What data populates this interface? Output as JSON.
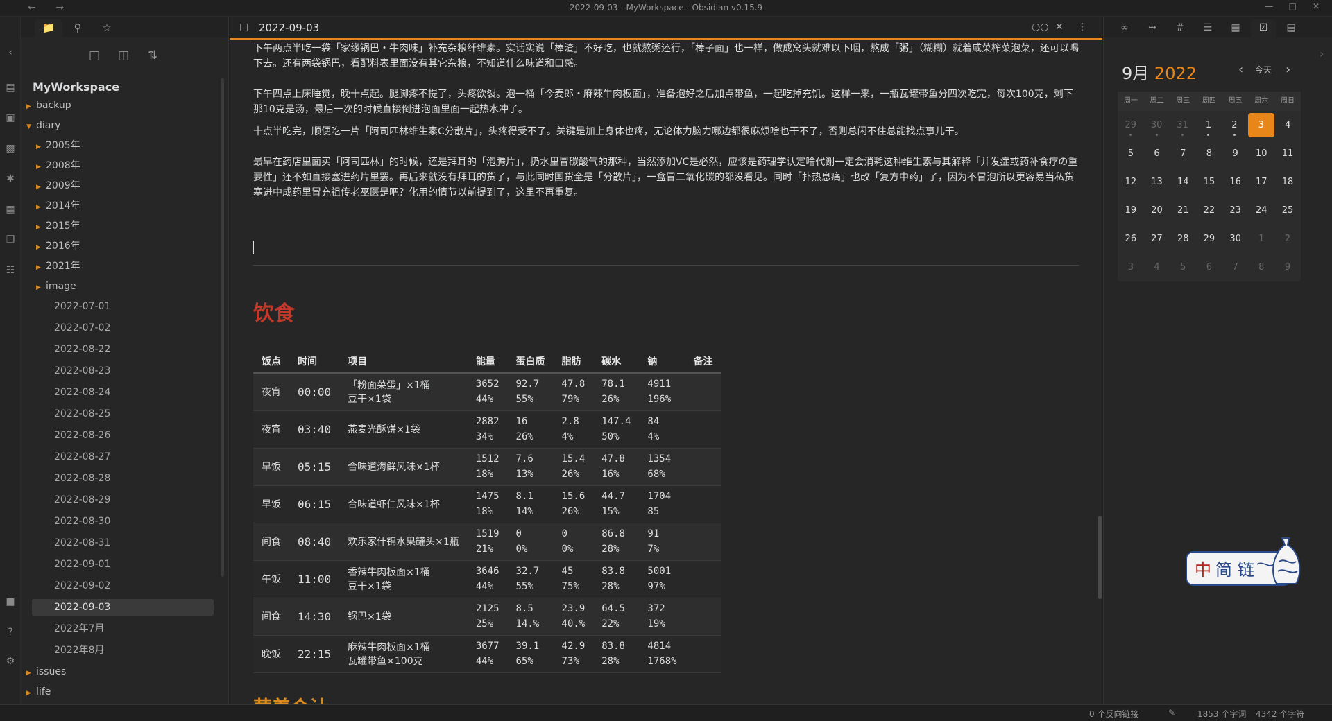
{
  "window": {
    "title": "2022-09-03 - MyWorkspace - Obsidian v0.15.9"
  },
  "left_sidebar": {
    "vault_name": "MyWorkspace",
    "tree": [
      {
        "label": "backup",
        "type": "folder",
        "level": 0
      },
      {
        "label": "diary",
        "type": "folder-open",
        "level": 0
      },
      {
        "label": "2005年",
        "type": "folder",
        "level": 1
      },
      {
        "label": "2008年",
        "type": "folder",
        "level": 1
      },
      {
        "label": "2009年",
        "type": "folder",
        "level": 1
      },
      {
        "label": "2014年",
        "type": "folder",
        "level": 1
      },
      {
        "label": "2015年",
        "type": "folder",
        "level": 1
      },
      {
        "label": "2016年",
        "type": "folder",
        "level": 1
      },
      {
        "label": "2021年",
        "type": "folder",
        "level": 1
      },
      {
        "label": "image",
        "type": "folder",
        "level": 1
      },
      {
        "label": "2022-07-01",
        "type": "file",
        "level": 1
      },
      {
        "label": "2022-07-02",
        "type": "file",
        "level": 1
      },
      {
        "label": "2022-08-22",
        "type": "file",
        "level": 1
      },
      {
        "label": "2022-08-23",
        "type": "file",
        "level": 1
      },
      {
        "label": "2022-08-24",
        "type": "file",
        "level": 1
      },
      {
        "label": "2022-08-25",
        "type": "file",
        "level": 1
      },
      {
        "label": "2022-08-26",
        "type": "file",
        "level": 1
      },
      {
        "label": "2022-08-27",
        "type": "file",
        "level": 1
      },
      {
        "label": "2022-08-28",
        "type": "file",
        "level": 1
      },
      {
        "label": "2022-08-29",
        "type": "file",
        "level": 1
      },
      {
        "label": "2022-08-30",
        "type": "file",
        "level": 1
      },
      {
        "label": "2022-08-31",
        "type": "file",
        "level": 1
      },
      {
        "label": "2022-09-01",
        "type": "file",
        "level": 1
      },
      {
        "label": "2022-09-02",
        "type": "file",
        "level": 1
      },
      {
        "label": "2022-09-03",
        "type": "file",
        "level": 1,
        "active": true
      },
      {
        "label": "2022年7月",
        "type": "file",
        "level": 1
      },
      {
        "label": "2022年8月",
        "type": "file",
        "level": 1
      },
      {
        "label": "issues",
        "type": "folder",
        "level": 0
      },
      {
        "label": "life",
        "type": "folder",
        "level": 0
      }
    ]
  },
  "editor": {
    "tab_title": "2022-09-03",
    "paragraphs": [
      "下午两点半吃一袋「家缘锅巴・牛肉味」补充杂粮纤维素。实话实说「棒渣」不好吃，也就熬粥还行，「棒子面」也一样，做成窝头就难以下咽，熬成「粥」（糊糊）就着咸菜榨菜泡菜，还可以喝下去。还有两袋锅巴，看配料表里面没有其它杂粮，不知道什么味道和口感。",
      "下午四点上床睡觉，晚十点起。腿脚疼不提了，头疼欲裂。泡一桶「今麦郎・麻辣牛肉板面」，准备泡好之后加点带鱼，一起吃掉充饥。这样一来，一瓶瓦罐带鱼分四次吃完，每次100克，剩下那10克是汤，最后一次的时候直接倒进泡面里面一起热水冲了。",
      "十点半吃完，顺便吃一片「阿司匹林维生素C分散片」，头疼得受不了。关键是加上身体也疼，无论体力脑力哪边都很麻烦啥也干不了，否则总闲不住总能找点事儿干。",
      "最早在药店里面买「阿司匹林」的时候，还是拜耳的「泡腾片」，扔水里冒碳酸气的那种，当然添加VC是必然，应该是药理学认定啥代谢一定会消耗这种维生素与其解释「并发症或药补食疗の重要性」还不如直接塞进药片里罢。再后来就没有拜耳的货了，与此同时国货全是「分散片」，一盒冒二氧化碳的都没看见。同时「扑热息痛」也改「复方中药」了，因为不冒泡所以更容易当私货塞进中成药里冒充祖传老巫医是吧？化用的情节以前提到了，这里不再重复。"
    ],
    "heading_food": "饮食",
    "heading_nutrition": "营养合计",
    "table": {
      "headers": [
        "饭点",
        "时间",
        "项目",
        "能量",
        "蛋白质",
        "脂肪",
        "碳水",
        "钠",
        "备注"
      ],
      "rows": [
        {
          "meal": "夜宵",
          "time": "00:00",
          "item1": "「粉面菜蛋」×1桶",
          "item2": "豆干×1袋",
          "energy": "3652",
          "energy_pct": "44%",
          "protein": "92.7",
          "protein_pct": "55%",
          "fat": "47.8",
          "fat_pct": "79%",
          "carb": "78.1",
          "carb_pct": "26%",
          "sodium": "4911",
          "sodium_pct": "196%",
          "note": ""
        },
        {
          "meal": "夜宵",
          "time": "03:40",
          "item1": "燕麦光酥饼×1袋",
          "item2": "",
          "energy": "2882",
          "energy_pct": "34%",
          "protein": "16",
          "protein_pct": "26%",
          "fat": "2.8",
          "fat_pct": "4%",
          "carb": "147.4",
          "carb_pct": "50%",
          "sodium": "84",
          "sodium_pct": "4%",
          "note": ""
        },
        {
          "meal": "早饭",
          "time": "05:15",
          "item1": "合味道海鲜风味×1杯",
          "item2": "",
          "energy": "1512",
          "energy_pct": "18%",
          "protein": "7.6",
          "protein_pct": "13%",
          "fat": "15.4",
          "fat_pct": "26%",
          "carb": "47.8",
          "carb_pct": "16%",
          "sodium": "1354",
          "sodium_pct": "68%",
          "note": ""
        },
        {
          "meal": "早饭",
          "time": "06:15",
          "item1": "合味道虾仁风味×1杯",
          "item2": "",
          "energy": "1475",
          "energy_pct": "18%",
          "protein": "8.1",
          "protein_pct": "14%",
          "fat": "15.6",
          "fat_pct": "26%",
          "carb": "44.7",
          "carb_pct": "15%",
          "sodium": "1704",
          "sodium_pct": "85",
          "note": ""
        },
        {
          "meal": "间食",
          "time": "08:40",
          "item1": "欢乐家什锦水果罐头×1瓶",
          "item2": "",
          "energy": "1519",
          "energy_pct": "21%",
          "protein": "0",
          "protein_pct": "0%",
          "fat": "0",
          "fat_pct": "0%",
          "carb": "86.8",
          "carb_pct": "28%",
          "sodium": "91",
          "sodium_pct": "7%",
          "note": ""
        },
        {
          "meal": "午饭",
          "time": "11:00",
          "item1": "香辣牛肉板面×1桶",
          "item2": "豆干×1袋",
          "energy": "3646",
          "energy_pct": "44%",
          "protein": "32.7",
          "protein_pct": "55%",
          "fat": "45",
          "fat_pct": "75%",
          "carb": "83.8",
          "carb_pct": "28%",
          "sodium": "5001",
          "sodium_pct": "97%",
          "note": ""
        },
        {
          "meal": "间食",
          "time": "14:30",
          "item1": "锅巴×1袋",
          "item2": "",
          "energy": "2125",
          "energy_pct": "25%",
          "protein": "8.5",
          "protein_pct": "14.%",
          "fat": "23.9",
          "fat_pct": "40.%",
          "carb": "64.5",
          "carb_pct": "22%",
          "sodium": "372",
          "sodium_pct": "19%",
          "note": ""
        },
        {
          "meal": "晚饭",
          "time": "22:15",
          "item1": "麻辣牛肉板面×1桶",
          "item2": "瓦罐带鱼×100克",
          "energy": "3677",
          "energy_pct": "44%",
          "protein": "39.1",
          "protein_pct": "65%",
          "fat": "42.9",
          "fat_pct": "73%",
          "carb": "83.8",
          "carb_pct": "28%",
          "sodium": "4814",
          "sodium_pct": "1768%",
          "note": ""
        }
      ]
    }
  },
  "calendar": {
    "month": "9月",
    "year": "2022",
    "today_label": "今天",
    "weekdays": [
      "周一",
      "周二",
      "周三",
      "周四",
      "周五",
      "周六",
      "周日"
    ],
    "weeks": [
      [
        {
          "d": "29",
          "dim": true,
          "dot": true
        },
        {
          "d": "30",
          "dim": true,
          "dot": true
        },
        {
          "d": "31",
          "dim": true,
          "dot": true
        },
        {
          "d": "1",
          "dot": true
        },
        {
          "d": "2",
          "dot": true
        },
        {
          "d": "3",
          "today": true
        },
        {
          "d": "4"
        }
      ],
      [
        {
          "d": "5"
        },
        {
          "d": "6"
        },
        {
          "d": "7"
        },
        {
          "d": "8"
        },
        {
          "d": "9"
        },
        {
          "d": "10"
        },
        {
          "d": "11"
        }
      ],
      [
        {
          "d": "12"
        },
        {
          "d": "13"
        },
        {
          "d": "14"
        },
        {
          "d": "15"
        },
        {
          "d": "16"
        },
        {
          "d": "17"
        },
        {
          "d": "18"
        }
      ],
      [
        {
          "d": "19"
        },
        {
          "d": "20"
        },
        {
          "d": "21"
        },
        {
          "d": "22"
        },
        {
          "d": "23"
        },
        {
          "d": "24"
        },
        {
          "d": "25"
        }
      ],
      [
        {
          "d": "26"
        },
        {
          "d": "27"
        },
        {
          "d": "28"
        },
        {
          "d": "29"
        },
        {
          "d": "30"
        },
        {
          "d": "1",
          "dim": true
        },
        {
          "d": "2",
          "dim": true
        }
      ],
      [
        {
          "d": "3",
          "dim": true
        },
        {
          "d": "4",
          "dim": true
        },
        {
          "d": "5",
          "dim": true
        },
        {
          "d": "6",
          "dim": true
        },
        {
          "d": "7",
          "dim": true
        },
        {
          "d": "8",
          "dim": true
        },
        {
          "d": "9",
          "dim": true
        }
      ]
    ]
  },
  "logo": {
    "text": "中简链"
  },
  "status_bar": {
    "backlinks": "0 个反向链接",
    "words": "1853 个字词",
    "chars": "4342 个字符"
  },
  "colors": {
    "accent": "#e8861a",
    "heading_red": "#c0392b",
    "heading_orange": "#d98a1e"
  }
}
